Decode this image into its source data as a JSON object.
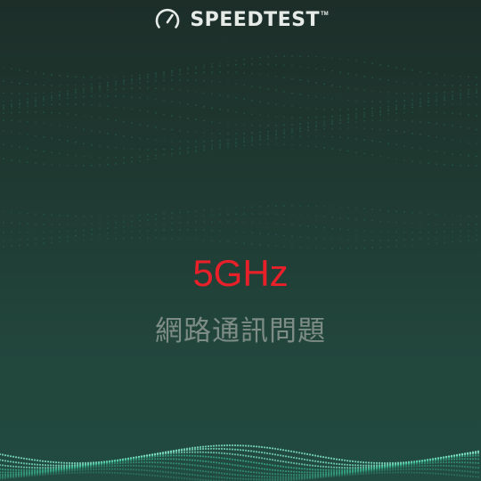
{
  "header": {
    "brand": "SPEEDTEST",
    "trademark": "TM",
    "logo_icon": "speedometer-gauge-icon"
  },
  "content": {
    "band_label": "5GHz",
    "subtitle": "網路通訊問題"
  },
  "colors": {
    "background_top": "#1d2e29",
    "background_bottom": "#214a40",
    "brand_text": "#e6ebe8",
    "band_label": "#e8202a",
    "subtitle": "#7e8c86",
    "particles": "#2f8f77"
  }
}
